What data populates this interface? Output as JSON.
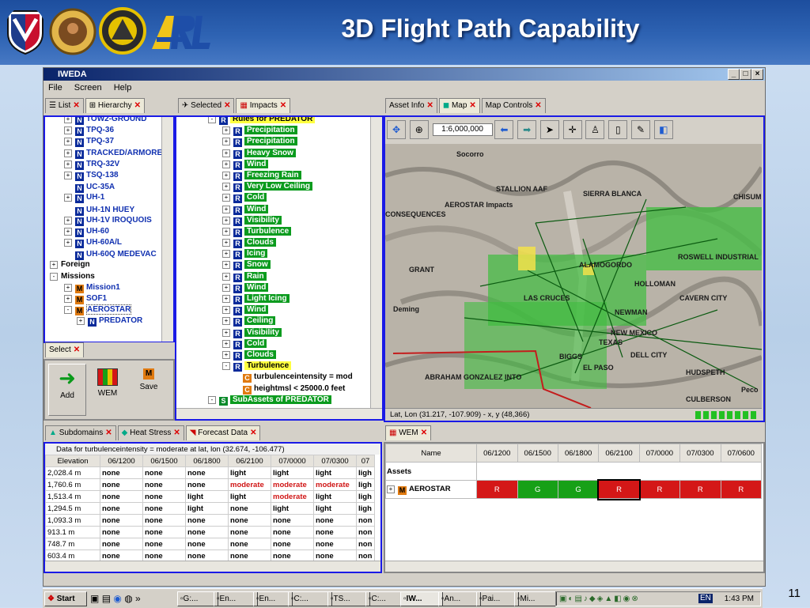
{
  "slide": {
    "title": "3D Flight Path Capability",
    "number": "11"
  },
  "colors": {
    "header": "#2e63b3",
    "pane_border": "#1a1ae6",
    "green": "#0b9b1e",
    "red": "#d41717"
  },
  "window": {
    "title": "IWEDA",
    "menu": [
      "File",
      "Screen",
      "Help"
    ],
    "controls": [
      "_",
      "□",
      "×"
    ]
  },
  "left_tabs": [
    "List",
    "Hierarchy"
  ],
  "tree": [
    {
      "label": "TOW2-GROUND",
      "exp": "+",
      "icon": "N"
    },
    {
      "label": "TPQ-36",
      "exp": "+",
      "icon": "N"
    },
    {
      "label": "TPQ-37",
      "exp": "+",
      "icon": "N"
    },
    {
      "label": "TRACKED/ARMORE",
      "exp": "+",
      "icon": "N"
    },
    {
      "label": "TRQ-32V",
      "exp": "+",
      "icon": "N"
    },
    {
      "label": "TSQ-138",
      "exp": "+",
      "icon": "N"
    },
    {
      "label": "UC-35A",
      "exp": "",
      "icon": "N"
    },
    {
      "label": "UH-1",
      "exp": "+",
      "icon": "N"
    },
    {
      "label": "UH-1N HUEY",
      "exp": "",
      "icon": "N"
    },
    {
      "label": "UH-1V IROQUOIS",
      "exp": "+",
      "icon": "N"
    },
    {
      "label": "UH-60",
      "exp": "+",
      "icon": "N"
    },
    {
      "label": "UH-60A/L",
      "exp": "+",
      "icon": "N"
    },
    {
      "label": "UH-60Q MEDEVAC",
      "exp": "",
      "icon": "N"
    },
    {
      "label": "Foreign",
      "exp": "+",
      "icon": ""
    },
    {
      "label": "Missions",
      "exp": "-",
      "icon": ""
    },
    {
      "label": "Mission1",
      "exp": "+",
      "icon": "M"
    },
    {
      "label": "SOF1",
      "exp": "+",
      "icon": "M"
    },
    {
      "label": "AEROSTAR",
      "exp": "-",
      "icon": "M"
    },
    {
      "label": "PREDATOR",
      "exp": "+",
      "icon": "N"
    }
  ],
  "select_panel": {
    "tab": "Select",
    "buttons": [
      {
        "label": "Add",
        "icon": "arrow-icon"
      },
      {
        "label": "WEM",
        "icon": "grid-icon"
      },
      {
        "label": "Save",
        "icon": "save-icon"
      }
    ]
  },
  "middle_tabs": [
    "Selected",
    "Impacts"
  ],
  "rules_header": "Rules for PREDATOR",
  "rules": [
    "Precipitation",
    "Precipitation",
    "Heavy Snow",
    "Wind",
    "Freezing Rain",
    "Very Low Ceiling",
    "Cold",
    "Wind",
    "Visibility",
    "Turbulence",
    "Clouds",
    "Icing",
    "Snow",
    "Rain",
    "Wind",
    "Light Icing",
    "Wind",
    "Ceiling",
    "Visibility",
    "Cold",
    "Clouds"
  ],
  "turbulence": {
    "label": "Turbulence",
    "conditions": [
      "turbulenceintensity = mod",
      "heightmsl < 25000.0 feet"
    ]
  },
  "subassets": "SubAssets of PREDATOR",
  "right_tabs": [
    "Asset Info",
    "Map",
    "Map Controls"
  ],
  "map": {
    "scale": "1:6,000,000",
    "coords": "Lat, Lon (31.217, -107.909) - x, y (48,366)",
    "places": [
      "Socorro",
      "STALLION AAF",
      "SIERRA BLANCA",
      "CHISUM",
      "CONSEQUENCES",
      "ALAMOGORDO",
      "ROSWELL INDUSTRIAL",
      "HOLLOMAN",
      "GRANT",
      "LAS CRUCES",
      "CAVERN CITY",
      "Deming",
      "NEWMAN",
      "NEW MEXICO",
      "TEXAS",
      "DELL CITY",
      "EL PASO",
      "HUDSPETH",
      "BIGGS",
      "ABRAHAM GONZALEZ INTO",
      "CULBERSON",
      "Peco",
      "AEROSTAR Impacts"
    ]
  },
  "bottom_tabs": [
    "Subdomains",
    "Heat Stress",
    "Forecast Data"
  ],
  "forecast": {
    "caption": "Data for turbulenceintensity = moderate at lat, lon (32.674, -106.477)",
    "columns": [
      "Elevation",
      "06/1200",
      "06/1500",
      "06/1800",
      "06/2100",
      "07/0000",
      "07/0300",
      "07"
    ],
    "rows": [
      [
        "2,028.4 m",
        "none",
        "none",
        "none",
        "light",
        "light",
        "light",
        "ligh"
      ],
      [
        "1,760.6 m",
        "none",
        "none",
        "none",
        "moderate",
        "moderate",
        "moderate",
        "ligh"
      ],
      [
        "1,513.4 m",
        "none",
        "none",
        "light",
        "light",
        "moderate",
        "light",
        "ligh"
      ],
      [
        "1,294.5 m",
        "none",
        "none",
        "light",
        "none",
        "light",
        "light",
        "ligh"
      ],
      [
        "1,093.3 m",
        "none",
        "none",
        "none",
        "none",
        "none",
        "none",
        "non"
      ],
      [
        "913.1 m",
        "none",
        "none",
        "none",
        "none",
        "none",
        "none",
        "non"
      ],
      [
        "748.7 m",
        "none",
        "none",
        "none",
        "none",
        "none",
        "none",
        "non"
      ],
      [
        "603.4 m",
        "none",
        "none",
        "none",
        "none",
        "none",
        "none",
        "non"
      ]
    ]
  },
  "wem": {
    "tab": "WEM",
    "columns": [
      "Name",
      "06/1200",
      "06/1500",
      "06/1800",
      "06/2100",
      "07/0000",
      "07/0300",
      "07/0600"
    ],
    "assets_label": "Assets",
    "asset": "AEROSTAR",
    "cells": [
      "R",
      "G",
      "G",
      "R",
      "R",
      "R",
      "R"
    ]
  },
  "taskbar": {
    "start": "Start",
    "items": [
      "G:...",
      "En...",
      "En...",
      "C:...",
      "TS...",
      "C:...",
      "IW...",
      "An...",
      "Pai...",
      "Mi..."
    ],
    "lang": "EN",
    "time": "1:43 PM"
  }
}
